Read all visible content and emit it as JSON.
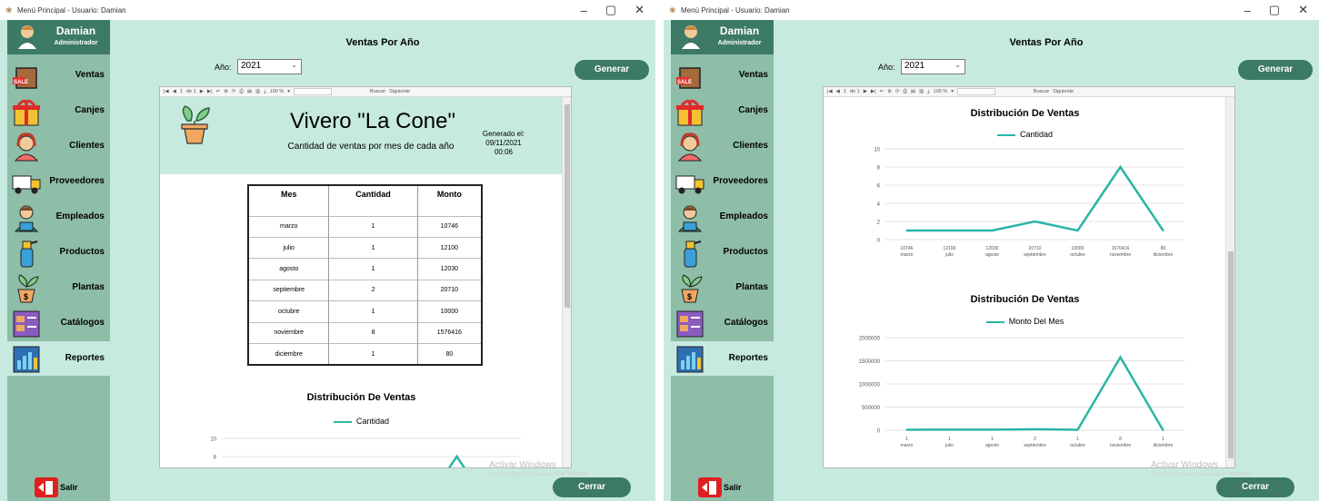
{
  "window_title": "Menú Principal - Usuario: Damian",
  "user": {
    "name": "Damian",
    "role": "Administrador"
  },
  "nav": [
    "Ventas",
    "Canjes",
    "Clientes",
    "Proveedores",
    "Empleados",
    "Productos",
    "Plantas",
    "Catálogos",
    "Reportes"
  ],
  "nav_icons": [
    "sale-bag-icon",
    "gift-icon",
    "client-icon",
    "truck-icon",
    "employee-icon",
    "spray-bottle-icon",
    "plant-pot-icon",
    "catalog-icon",
    "report-icon"
  ],
  "active_nav": "Reportes",
  "salir": "Salir",
  "page_title": "Ventas Por Año",
  "year_label": "Año:",
  "year_value": "2021",
  "generar": "Generar",
  "cerrar": "Cerrar",
  "toolbar": {
    "page": "1",
    "of": "de 1",
    "zoom": "100 %",
    "buscar": "Buscar",
    "siguiente": "Siguiente"
  },
  "report": {
    "title": "Vivero \"La Cone\"",
    "subtitle": "Cantidad de ventas por mes de cada año",
    "generated_label": "Generado el:",
    "generated_date": "09/11/2021",
    "generated_time": "00:06",
    "table_headers": [
      "Mes",
      "Cantidad",
      "Monto"
    ],
    "rows": [
      [
        "marzo",
        "1",
        "10746"
      ],
      [
        "julio",
        "1",
        "12100"
      ],
      [
        "agosto",
        "1",
        "12030"
      ],
      [
        "septiembre",
        "2",
        "20710"
      ],
      [
        "octubre",
        "1",
        "10000"
      ],
      [
        "noviembre",
        "8",
        "1576416"
      ],
      [
        "diciembre",
        "1",
        "80"
      ]
    ]
  },
  "watermark": {
    "line1": "Activar Windows",
    "line2": "Ve a Configuración para activar Windows."
  },
  "colors": {
    "accent": "#3d7a66",
    "background": "#c7eae0",
    "sidebar": "#8ebda8",
    "series": "#2bb5a5"
  },
  "chart_data": [
    {
      "type": "line",
      "title": "Distribución De Ventas",
      "categories": [
        "marzo",
        "julio",
        "agosto",
        "septiembre",
        "octubre",
        "noviembre",
        "diciembre"
      ],
      "category_labels": [
        "10746",
        "12100",
        "12030",
        "20710",
        "10000",
        "1576416",
        "80"
      ],
      "series": [
        {
          "name": "Cantidad",
          "values": [
            1,
            1,
            1,
            2,
            1,
            8,
            1
          ]
        }
      ],
      "ylim": [
        0,
        10
      ],
      "yticks": [
        0,
        2,
        4,
        6,
        8,
        10
      ],
      "legend": "top",
      "grid": true
    },
    {
      "type": "line",
      "title": "Distribución De Ventas",
      "categories": [
        "marzo",
        "julio",
        "agosto",
        "septiembre",
        "octubre",
        "noviembre",
        "diciembre"
      ],
      "category_labels": [
        "1",
        "1",
        "1",
        "2",
        "1",
        "8",
        "1"
      ],
      "series": [
        {
          "name": "Monto Del Mes",
          "values": [
            10746,
            12100,
            12030,
            20710,
            10000,
            1576416,
            80
          ]
        }
      ],
      "ylim": [
        0,
        2000000
      ],
      "yticks": [
        0,
        500000,
        1000000,
        1500000,
        2000000
      ],
      "legend": "top",
      "grid": true
    }
  ]
}
